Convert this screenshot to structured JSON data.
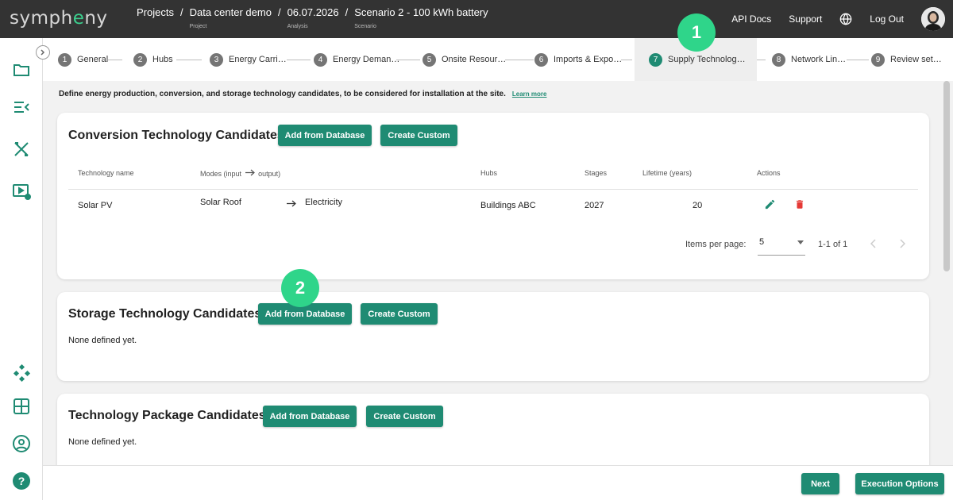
{
  "brand": {
    "logo_pre": "symph",
    "logo_e": "e",
    "logo_post": "ny",
    "accent": "#1f8b73",
    "highlight": "#2fd58a"
  },
  "breadcrumb": [
    {
      "main": "Projects",
      "sub": ""
    },
    {
      "main": "Data center demo",
      "sub": "Project"
    },
    {
      "main": "06.07.2026",
      "sub": "Analysis"
    },
    {
      "main": "Scenario 2 - 100 kWh battery",
      "sub": "Scenario"
    }
  ],
  "breadcrumb_sep": "/",
  "header": {
    "api_docs": "API Docs",
    "support": "Support",
    "logout": "Log Out"
  },
  "sidebar_icons": [
    "folder-icon",
    "list-collapse-icon",
    "tools-icon",
    "play-settings-icon",
    "network-icon",
    "grid-icon",
    "user-icon",
    "help-icon"
  ],
  "steps": [
    {
      "num": "1",
      "label": "General"
    },
    {
      "num": "2",
      "label": "Hubs"
    },
    {
      "num": "3",
      "label": "Energy Carri…"
    },
    {
      "num": "4",
      "label": "Energy Deman…"
    },
    {
      "num": "5",
      "label": "Onsite Resour…"
    },
    {
      "num": "6",
      "label": "Imports & Expo…"
    },
    {
      "num": "7",
      "label": "Supply Technolog…"
    },
    {
      "num": "8",
      "label": "Network Lin…"
    },
    {
      "num": "9",
      "label": "Review set…"
    }
  ],
  "description": "Define energy production, conversion, and storage technology candidates, to be considered for installation at the site.",
  "learn_more": "Learn more",
  "conversion": {
    "title": "Conversion Technology Candidates",
    "add_btn": "Add from Database",
    "custom_btn": "Create Custom",
    "columns": {
      "name": "Technology name",
      "modes": "Modes (input",
      "modes_out": "output)",
      "hubs": "Hubs",
      "stages": "Stages",
      "lifetime": "Lifetime (years)",
      "actions": "Actions"
    },
    "rows": [
      {
        "name": "Solar PV",
        "input": "Solar Roof",
        "output": "Electricity",
        "hubs": "Buildings ABC",
        "stages": "2027",
        "lifetime": "20"
      }
    ],
    "pager": {
      "label": "Items per page:",
      "value": "5",
      "range": "1-1 of 1"
    }
  },
  "storage": {
    "title": "Storage Technology Candidates",
    "add_btn": "Add from Database",
    "custom_btn": "Create Custom",
    "empty": "None defined yet."
  },
  "package": {
    "title": "Technology Package Candidates",
    "add_btn": "Add from Database",
    "custom_btn": "Create Custom",
    "empty": "None defined yet."
  },
  "callouts": [
    "1",
    "2"
  ],
  "footer": {
    "next": "Next",
    "exec": "Execution Options"
  }
}
